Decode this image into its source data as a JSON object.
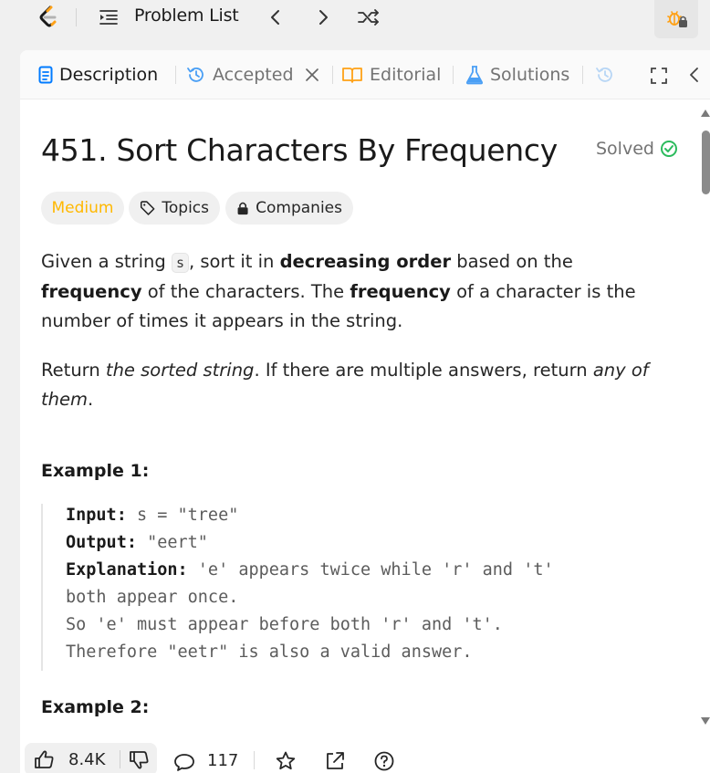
{
  "topbar": {
    "problem_list_label": "Problem List",
    "icons": [
      "leetcode-logo",
      "list-icon",
      "chevron-left-icon",
      "chevron-right-icon",
      "shuffle-icon",
      "bug-lock-icon"
    ]
  },
  "tabs": [
    {
      "label": "Description",
      "icon": "description-icon",
      "active": true
    },
    {
      "label": "Accepted",
      "icon": "history-icon",
      "closable": true
    },
    {
      "label": "Editorial",
      "icon": "book-icon"
    },
    {
      "label": "Solutions",
      "icon": "flask-icon"
    }
  ],
  "problem": {
    "title": "451. Sort Characters By Frequency",
    "status": "Solved",
    "difficulty": "Medium",
    "topics_label": "Topics",
    "companies_label": "Companies",
    "desc": {
      "p1_a": "Given a string ",
      "p1_code": "s",
      "p1_b": ", sort it in ",
      "p1_bold1": "decreasing order",
      "p1_c": " based on the ",
      "p1_bold2": "frequency",
      "p1_d": " of the characters. The ",
      "p1_bold3": "frequency",
      "p1_e": " of a character is the number of times it appears in the string.",
      "p2_a": "Return ",
      "p2_it1": "the sorted string",
      "p2_b": ". If there are multiple answers, return ",
      "p2_it2": "any of them",
      "p2_c": "."
    },
    "example1": {
      "heading": "Example 1:",
      "input_label": "Input:",
      "input_value": " s = \"tree\"",
      "output_label": "Output:",
      "output_value": " \"eert\"",
      "explanation_label": "Explanation:",
      "explanation_line1": " 'e' appears twice while 'r' and 't'",
      "explanation_line2": "both appear once.",
      "explanation_line3": "So 'e' must appear before both 'r' and 't'.",
      "explanation_line4": "Therefore \"eetr\" is also a valid answer."
    },
    "example2": {
      "heading": "Example 2:"
    }
  },
  "bottombar": {
    "likes": "8.4K",
    "comments": "117"
  },
  "colors": {
    "medium": "#ffb800",
    "solved_check": "#2cbb5d",
    "description_icon": "#007bff",
    "editorial_icon": "#ffa116",
    "accent_blue": "#4a9ff5"
  }
}
